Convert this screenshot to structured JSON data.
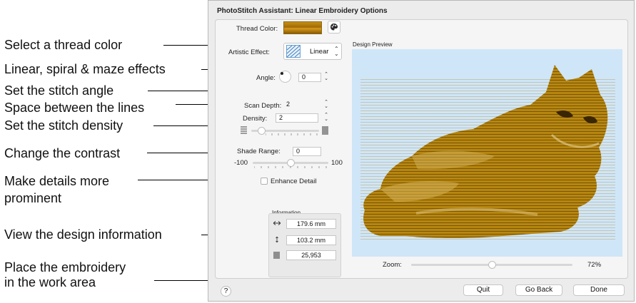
{
  "callouts": {
    "thread_color": "Select a thread color",
    "artistic_effect": "Linear, spiral & maze effects",
    "stitch_angle": "Set the stitch angle",
    "scan_depth": "Space between the lines",
    "density": "Set the stitch density",
    "contrast": "Change the contrast",
    "details_line1": "Make details more",
    "details_line2": "prominent",
    "info": "View the design information",
    "done_line1": "Place the embroidery",
    "done_line2": "in the work area"
  },
  "dialog": {
    "title": "PhotoStitch Assistant: Linear Embroidery Options",
    "thread_color_label": "Thread Color:",
    "thread_color_hex": "#b07a10",
    "artistic_effect_label": "Artistic Effect:",
    "artistic_effect_value": "Linear",
    "angle_label": "Angle:",
    "angle_value": "0",
    "scan_depth_label": "Scan Depth:",
    "scan_depth_value": "2",
    "density_label": "Density:",
    "density_value": "2",
    "shade_range_label": "Shade Range:",
    "shade_range_value": "0",
    "shade_min": "-100",
    "shade_max": "100",
    "enhance_detail_label": "Enhance Detail",
    "enhance_detail_checked": false,
    "information_label": "Information",
    "info_width": "179.6 mm",
    "info_height": "103.2 mm",
    "info_stitches": "25,953",
    "design_preview_label": "Design Preview",
    "zoom_label": "Zoom:",
    "zoom_value": "72%",
    "zoom_level": 0.5,
    "buttons": {
      "help": "?",
      "quit": "Quit",
      "go_back": "Go Back",
      "done": "Done"
    }
  }
}
